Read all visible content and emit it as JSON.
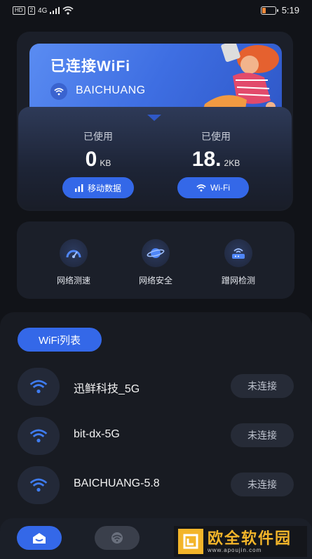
{
  "status_bar": {
    "left_indicators": [
      "HD",
      "2",
      "4G"
    ],
    "time": "5:19"
  },
  "banner": {
    "title": "已连接WiFi",
    "ssid": "BAICHUANG"
  },
  "usage": {
    "mobile": {
      "label": "已使用",
      "value": "0",
      "unit": "KB",
      "button": "移动数据"
    },
    "wifi": {
      "label": "已使用",
      "value": "18.",
      "unit": "2KB",
      "button": "Wi-Fi"
    }
  },
  "tools": [
    {
      "label": "网络测速",
      "icon": "speed-gauge-icon"
    },
    {
      "label": "网络安全",
      "icon": "planet-shield-icon"
    },
    {
      "label": "蹭网检测",
      "icon": "router-icon"
    }
  ],
  "wifi_list": {
    "tab_label": "WiFi列表",
    "networks": [
      {
        "name": "迅鲜科技_5G",
        "status": "未连接"
      },
      {
        "name": "bit-dx-5G",
        "status": "未连接"
      },
      {
        "name": "BAICHUANG-5.8",
        "status": "未连接"
      }
    ]
  },
  "bottom_nav": {
    "items": [
      {
        "icon": "home-icon",
        "active": true
      },
      {
        "icon": "wifi-icon",
        "active": false
      }
    ]
  },
  "watermark": {
    "title": "欧全软件园",
    "url": "www.apoujin.com"
  },
  "colors": {
    "accent": "#3468e8",
    "background": "#111318",
    "card": "#1b1f29",
    "watermark": "#f3b52a"
  }
}
